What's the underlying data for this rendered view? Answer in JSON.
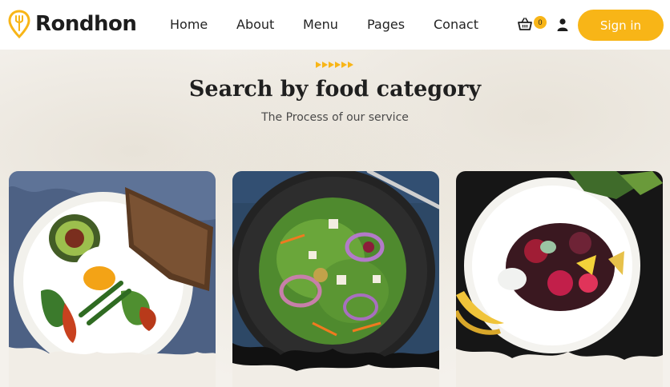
{
  "brand": {
    "name": "Rondhon",
    "accent": "#f8b517"
  },
  "nav": {
    "items": [
      {
        "label": "Home"
      },
      {
        "label": "About"
      },
      {
        "label": "Menu"
      },
      {
        "label": "Pages"
      },
      {
        "label": "Conact"
      }
    ]
  },
  "header": {
    "cart_count": "0",
    "cart_icon": "basket-icon",
    "user_icon": "user-icon",
    "signin_label": "Sign in"
  },
  "section": {
    "title": "Search by food category",
    "subtitle": "The Process of our service"
  },
  "cards": [
    {
      "image": "breakfast-plate-photo"
    },
    {
      "image": "green-salad-photo"
    },
    {
      "image": "fruit-plate-photo"
    }
  ]
}
